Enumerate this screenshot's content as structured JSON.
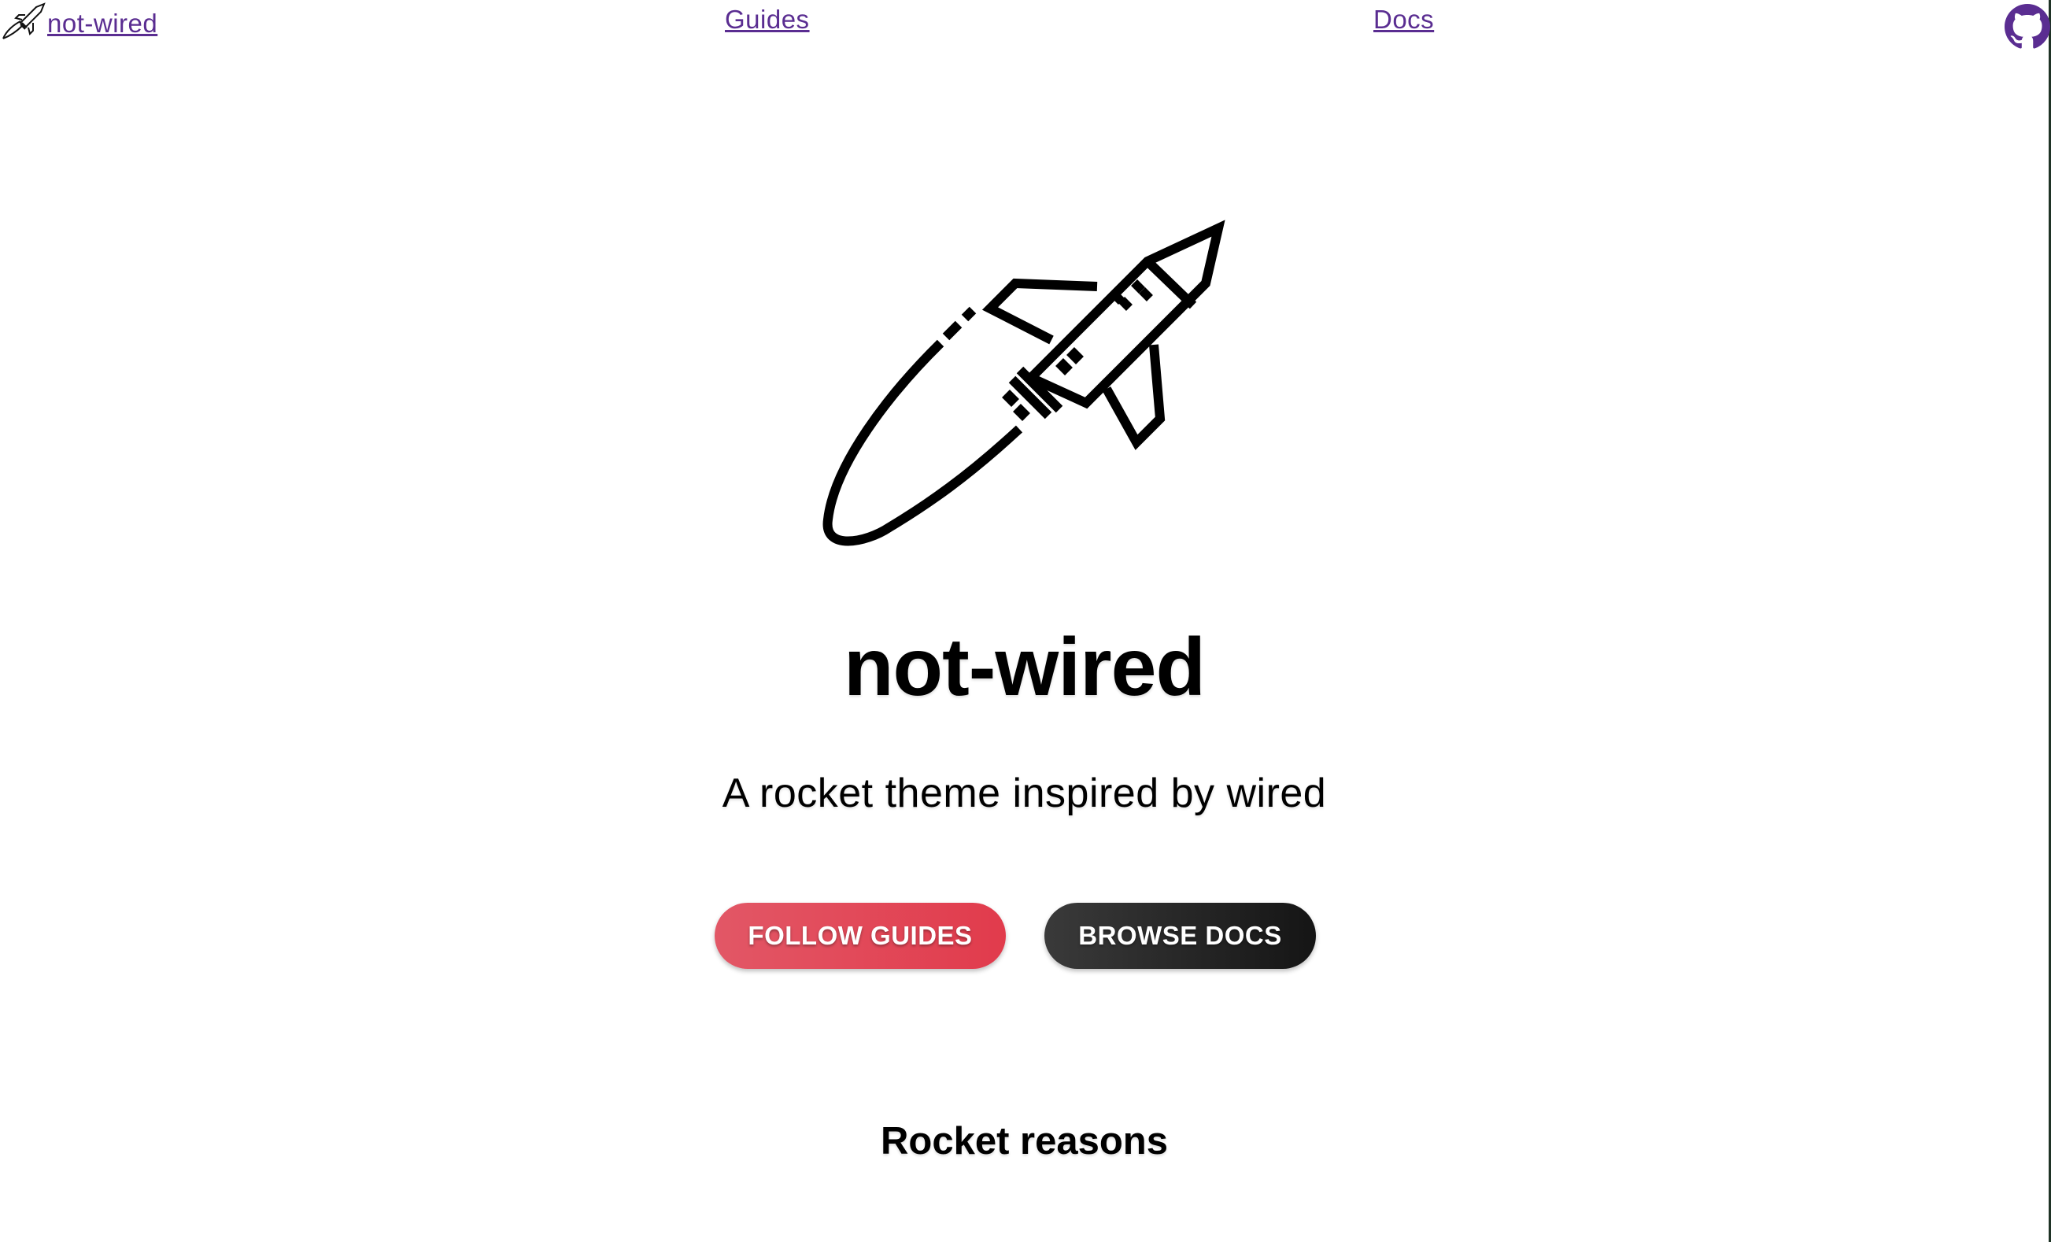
{
  "nav": {
    "brand_label": " not-wired",
    "brand_icon": "rocket-icon",
    "guides_label": "Guides",
    "docs_label": "Docs",
    "github_icon": "github-icon",
    "link_color": "#5a2d91"
  },
  "hero": {
    "illustration": "rocket-icon",
    "title": "not-wired",
    "subtitle": "A rocket theme inspired by wired",
    "primary_button": "FOLLOW GUIDES",
    "secondary_button": "BROWSE DOCS",
    "primary_color": "#e2424f",
    "secondary_color": "#222222"
  },
  "section": {
    "title": "Rocket reasons"
  }
}
